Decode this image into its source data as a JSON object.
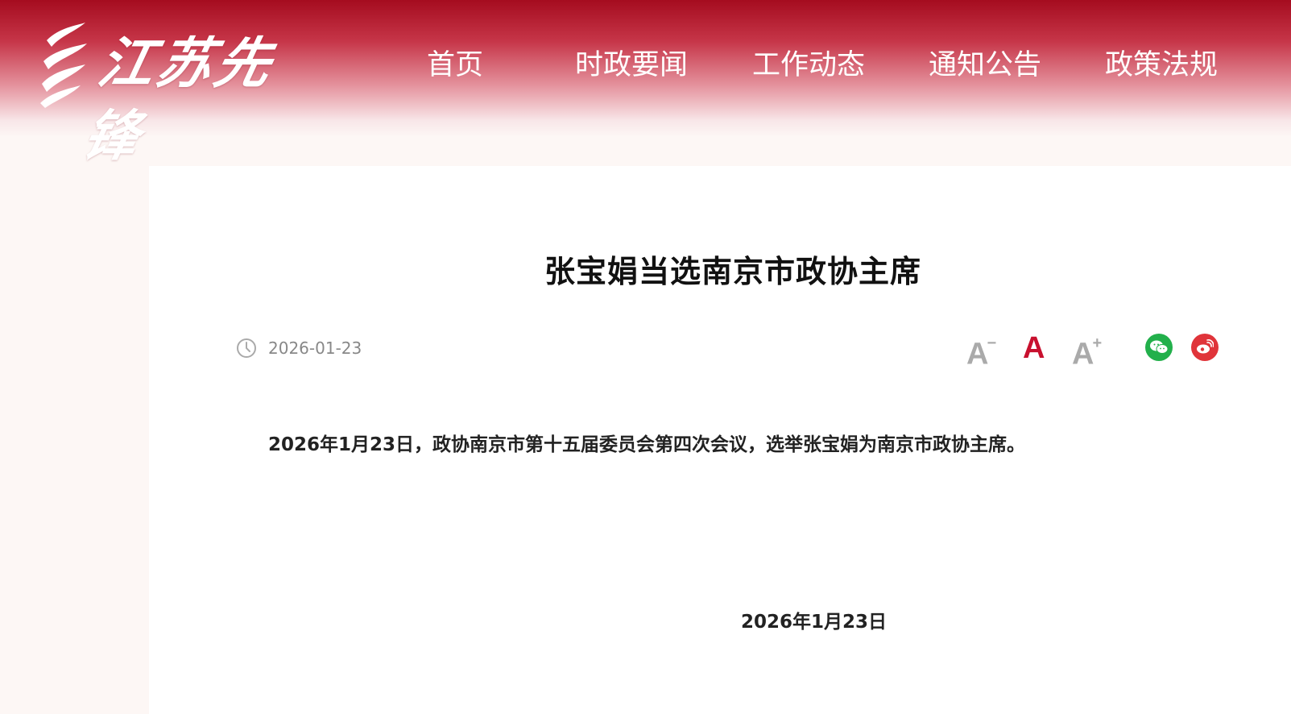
{
  "header": {
    "logo_text": "江苏先锋",
    "nav": [
      "首页",
      "时政要闻",
      "工作动态",
      "通知公告",
      "政策法规"
    ]
  },
  "article": {
    "title": "张宝娟当选南京市政协主席",
    "date": "2026-01-23",
    "body": "2026年1月23日，政协南京市第十五届委员会第四次会议，选举张宝娟为南京市政协主席。",
    "sign_date": "2026年1月23日"
  },
  "toolbar": {
    "font_small": "A",
    "font_small_mark": "−",
    "font_normal": "A",
    "font_large": "A",
    "font_large_mark": "+",
    "icons": [
      "clock-icon",
      "wechat-icon",
      "weibo-icon"
    ]
  },
  "colors": {
    "brand_red": "#a50c1f",
    "active_font": "#c8102e",
    "inactive_font": "#aaaaaa",
    "wechat": "#22b04b",
    "weibo": "#e0343a"
  }
}
